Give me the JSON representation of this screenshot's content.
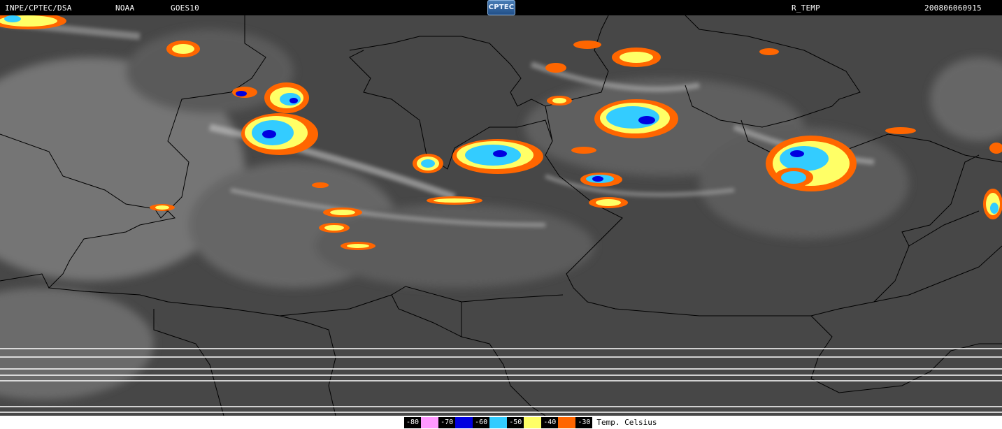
{
  "header": {
    "source": "INPE/CPTEC/DSA",
    "agency": "NOAA",
    "satellite": "GOES10",
    "logo_text": "CPTEC",
    "product": "R_TEMP",
    "timestamp": "200806060915"
  },
  "legend": {
    "items": [
      {
        "label": "-80",
        "color": "#ff99ff"
      },
      {
        "label": "-70",
        "color": "#0000e0"
      },
      {
        "label": "-60",
        "color": "#33ccff"
      },
      {
        "label": "-50",
        "color": "#ffff66"
      },
      {
        "label": "-40",
        "color": "#ff6600"
      },
      {
        "label": "-30",
        "color": "#ffffff"
      }
    ],
    "unit": "Temp. Celsius"
  },
  "colors": {
    "background": "#000000",
    "land_dark": "#3c3c3c",
    "cloud_light": "#b4b4b4",
    "border_line": "#000000"
  }
}
